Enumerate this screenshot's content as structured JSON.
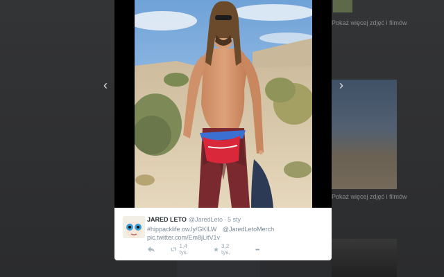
{
  "navigation": {
    "prev_arrow": "‹",
    "next_arrow": "›"
  },
  "background_feed": {
    "captions": [
      "Pokaż więcej zdjęć i filmów",
      "Pokaż więcej zdjęć i filmów"
    ]
  },
  "tweet": {
    "name": "JARED LETO",
    "handle": "@JaredLeto",
    "separator": "·",
    "timestamp": "5 sty",
    "text_hashtag": "#hippacklife",
    "text_link": "ow.ly/GKlLW",
    "text_mention": "@JaredLetoMerch",
    "pic_link": "pic.twitter.com/Em8jLitV1v",
    "retweet_count": "1,4 tys.",
    "favorite_count": "3,2 tys.",
    "more_label": "•••"
  },
  "colors": {
    "link": "#7a8a96",
    "name": "#292f33",
    "meta": "#8899a6",
    "actions": "#99a7b3"
  },
  "icons": [
    "reply-icon",
    "retweet-icon",
    "star-icon",
    "more-icon"
  ]
}
